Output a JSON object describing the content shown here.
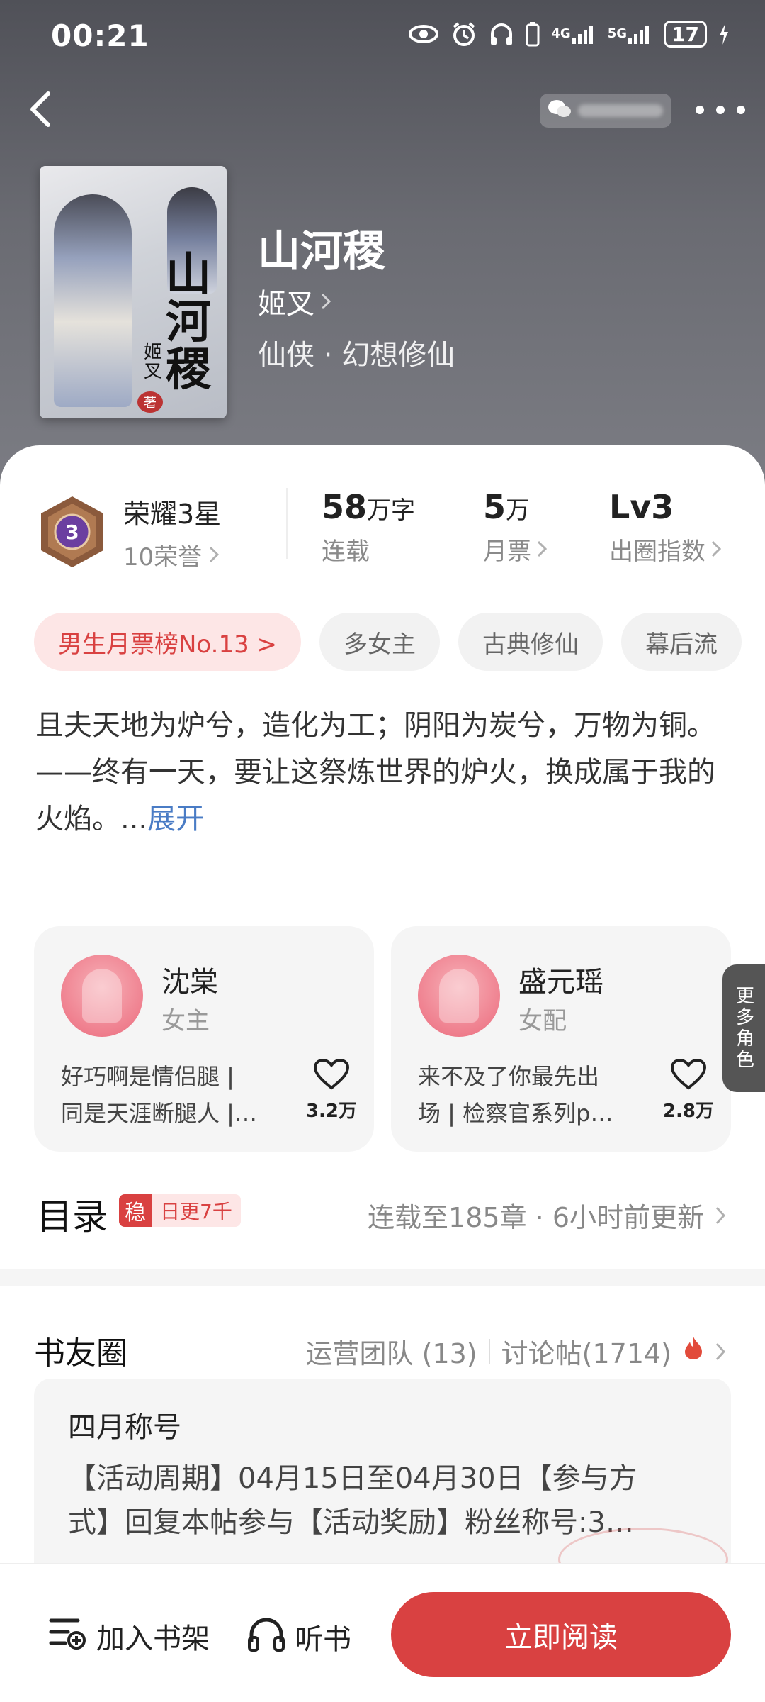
{
  "status_bar": {
    "time": "00:21",
    "network_1": "4G",
    "network_2": "5G",
    "battery": "17"
  },
  "book": {
    "title": "山河稷",
    "author": "姬叉",
    "category": "仙侠 · 幻想修仙",
    "cover_title": "山河稷",
    "cover_author": "姬叉",
    "cover_seal": "著"
  },
  "honor": {
    "level_number": "3",
    "title": "荣耀3星",
    "points": "10荣誉"
  },
  "stats": [
    {
      "value": "58",
      "unit": "万字",
      "label": "连载"
    },
    {
      "value": "5",
      "unit": "万",
      "label": "月票"
    },
    {
      "value": "Lv3",
      "unit": "",
      "label": "出圈指数"
    }
  ],
  "tags": [
    "男生月票榜No.13 >",
    "多女主",
    "古典修仙",
    "幕后流"
  ],
  "synopsis": {
    "line1": "且夫天地为炉兮，造化为工；阴阳为炭兮，万物为铜。",
    "line2": "——终有一天，要让这祭炼世界的炉火，换成属于我的火焰。...",
    "expand": "展开"
  },
  "characters": [
    {
      "name": "沈棠",
      "role": "女主",
      "desc_line1": "好巧啊是情侣腿 |",
      "desc_line2": "同是天涯断腿人 |…",
      "likes": "3.2万"
    },
    {
      "name": "盛元瑶",
      "role": "女配",
      "desc_line1": "来不及了你最先出",
      "desc_line2": "场 | 检察官系列p…",
      "likes": "2.8万"
    }
  ],
  "more_roles": "更多角色",
  "catalog": {
    "title": "目录",
    "badge_mark": "稳",
    "badge_text": "日更7千",
    "status": "连载至185章 · 6小时前更新"
  },
  "circle": {
    "title": "书友圈",
    "team": "运营团队 (13)",
    "posts": "讨论帖(1714)",
    "post_title": "四月称号",
    "post_line1": "【活动周期】04月15日至04月30日【参与方",
    "post_line2": "式】回复本帖参与【活动奖励】粉丝称号:3…"
  },
  "bottom_bar": {
    "add_shelf": "加入书架",
    "listen": "听书",
    "read_now": "立即阅读"
  },
  "colors": {
    "accent": "#d94141",
    "link": "#4a7cc5",
    "hero_bg": "#5e5f66"
  },
  "icons": [
    "back-icon",
    "wechat-icon",
    "more-icon",
    "eye-icon",
    "alarm-icon",
    "headphones-icon",
    "heart-icon",
    "fire-icon",
    "chevron-right-icon",
    "add-shelf-icon"
  ]
}
